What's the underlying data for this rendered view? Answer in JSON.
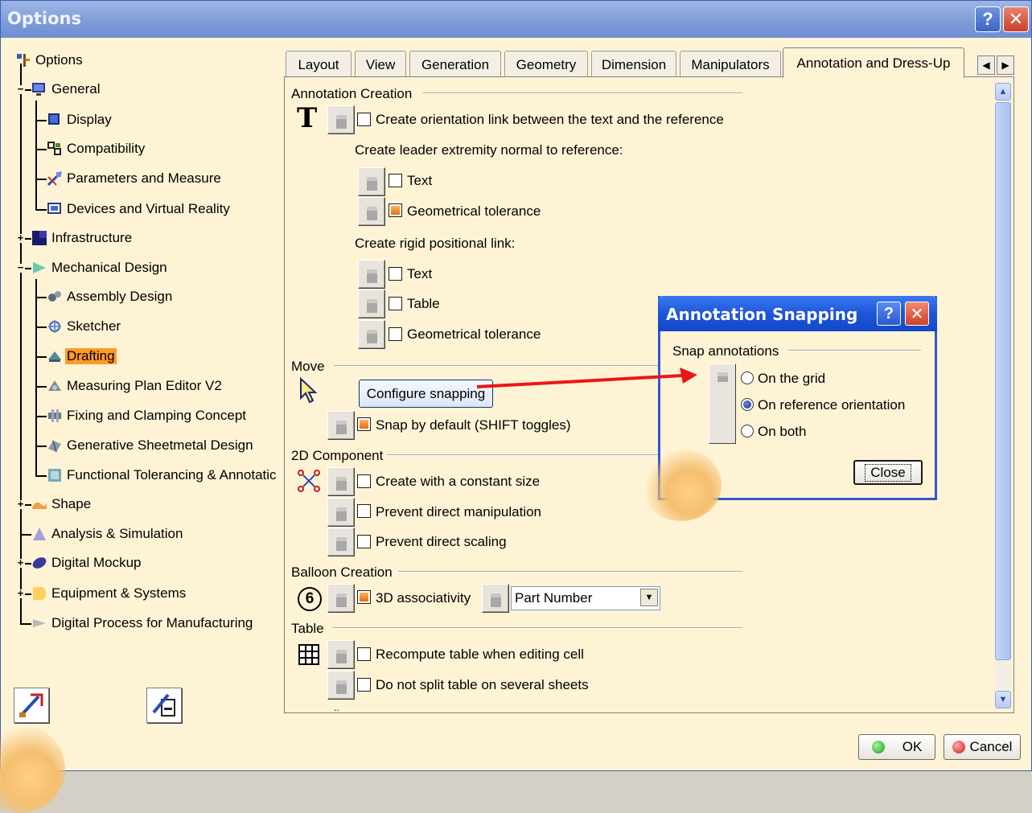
{
  "window": {
    "title": "Options",
    "help_label": "?",
    "close_label": "✕"
  },
  "tree": {
    "root": "Options",
    "items": [
      {
        "label": "General"
      },
      {
        "label": "Display"
      },
      {
        "label": "Compatibility"
      },
      {
        "label": "Parameters and Measure"
      },
      {
        "label": "Devices and Virtual Reality"
      },
      {
        "label": "Infrastructure"
      },
      {
        "label": "Mechanical Design"
      },
      {
        "label": "Assembly Design"
      },
      {
        "label": "Sketcher"
      },
      {
        "label": "Drafting"
      },
      {
        "label": "Measuring Plan Editor V2"
      },
      {
        "label": "Fixing and Clamping Concept"
      },
      {
        "label": "Generative Sheetmetal Design"
      },
      {
        "label": "Functional Tolerancing & Annotatic"
      },
      {
        "label": "Shape"
      },
      {
        "label": "Analysis & Simulation"
      },
      {
        "label": "Digital Mockup"
      },
      {
        "label": "Equipment & Systems"
      },
      {
        "label": "Digital Process for Manufacturing"
      }
    ]
  },
  "tabs": [
    {
      "label": "Layout"
    },
    {
      "label": "View"
    },
    {
      "label": "Generation"
    },
    {
      "label": "Geometry"
    },
    {
      "label": "Dimension"
    },
    {
      "label": "Manipulators"
    },
    {
      "label": "Annotation and Dress-Up"
    }
  ],
  "panel": {
    "annotation_creation": {
      "title": "Annotation Creation",
      "orientation_link": "Create orientation link between the text and the reference",
      "leader_title": "Create leader extremity normal to reference:",
      "leader_text": "Text",
      "leader_geom": "Geometrical tolerance",
      "rigid_title": "Create rigid positional link:",
      "rigid_text": "Text",
      "rigid_table": "Table",
      "rigid_geom": "Geometrical tolerance"
    },
    "move": {
      "title": "Move",
      "configure_button": "Configure snapping",
      "snap_default": "Snap by default (SHIFT toggles)"
    },
    "component_2d": {
      "title": "2D Component",
      "constant_size": "Create with a constant size",
      "prevent_manip": "Prevent direct manipulation",
      "prevent_scaling": "Prevent direct scaling"
    },
    "balloon": {
      "title": "Balloon Creation",
      "associativity": "3D associativity",
      "select_value": "Part Number",
      "icon_text": "6"
    },
    "table": {
      "title": "Table",
      "recompute": "Recompute table when editing cell",
      "no_split": "Do not split table on several sheets"
    }
  },
  "snap_dialog": {
    "title": "Annotation Snapping",
    "help_label": "?",
    "close_x": "✕",
    "group_title": "Snap annotations",
    "options": [
      "On the grid",
      "On reference orientation",
      "On both"
    ],
    "selected": "On reference orientation",
    "close_button": "Close"
  },
  "footer": {
    "ok": "OK",
    "cancel": "Cancel"
  },
  "colors": {
    "background": "#fff3d6",
    "selection": "#ff9a26",
    "arrow": "#e81818",
    "dialog_title": "#1e56d8"
  }
}
